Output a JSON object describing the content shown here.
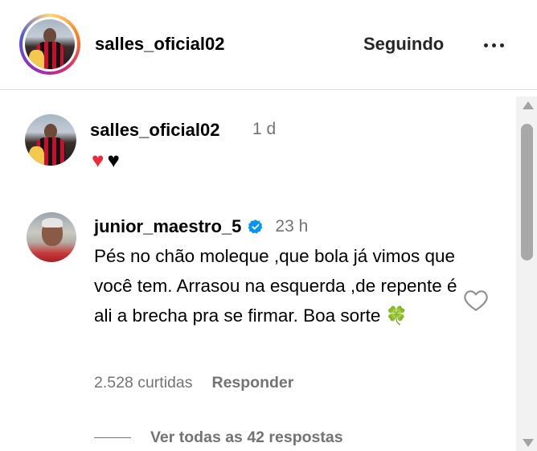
{
  "header": {
    "username": "salles_oficial02",
    "follow_label": "Seguindo",
    "more_icon": "more-horizontal-icon"
  },
  "caption": {
    "username": "salles_oficial02",
    "time": "1 d",
    "text": "❤️🖤",
    "hearts": [
      "♥",
      "♥"
    ],
    "heart_colors": [
      "#ed2939",
      "#000000"
    ]
  },
  "comment": {
    "username": "junior_maestro_5",
    "verified": true,
    "time": "23 h",
    "text": "Pés no chão moleque ,que bola já vimos que você tem. Arrasou na esquerda ,de repente é ali a brecha pra se firmar. Boa sorte",
    "emoji": "🍀",
    "likes": "2.528 curtidas",
    "reply_label": "Responder",
    "view_replies": "Ver todas as 42 respostas"
  },
  "colors": {
    "secondary_text": "#737373",
    "verified_blue": "#0095f6",
    "divider": "#dbdbdb"
  }
}
